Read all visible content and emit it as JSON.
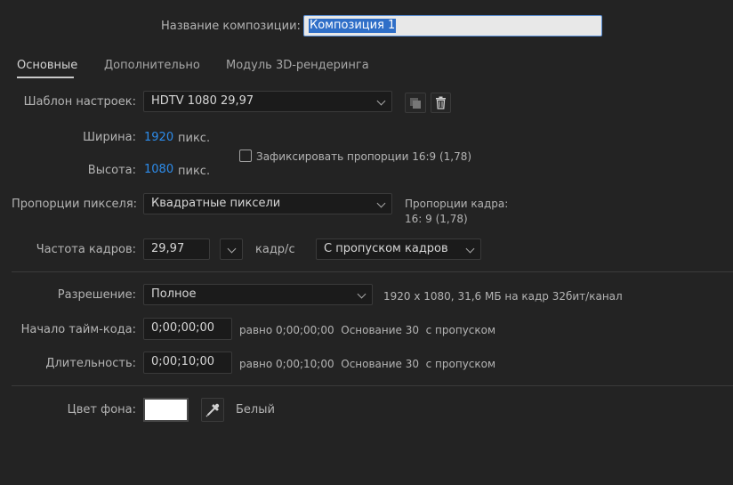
{
  "header": {
    "comp_name_label": "Название композиции:",
    "comp_name_value": "Композиция 1"
  },
  "tabs": [
    {
      "label": "Основные",
      "active": true
    },
    {
      "label": "Дополнительно",
      "active": false
    },
    {
      "label": "Модуль 3D-рендеринга",
      "active": false
    }
  ],
  "preset": {
    "label": "Шаблон настроек:",
    "value": "HDTV 1080 29,97",
    "save_icon": "save-preset-icon",
    "delete_icon": "trash-icon"
  },
  "dimensions": {
    "width_label": "Ширина:",
    "width_value": "1920",
    "height_label": "Высота:",
    "height_value": "1080",
    "unit": "пикс.",
    "lock_label": "Зафиксировать пропорции 16:9 (1,78)",
    "lock_checked": false
  },
  "pixel_aspect": {
    "label": "Пропорции пикселя:",
    "value": "Квадратные пиксели",
    "frame_aspect_label": "Пропорции кадра:",
    "frame_aspect_value": "16: 9 (1,78)"
  },
  "frame_rate": {
    "label": "Частота кадров:",
    "value": "29,97",
    "unit": "кадр/с",
    "mode": "С пропуском кадров"
  },
  "resolution": {
    "label": "Разрешение:",
    "value": "Полное",
    "info": "1920 x 1080, 31,6 МБ на кадр 32бит/канал"
  },
  "start_timecode": {
    "label": "Начало тайм-кода:",
    "value": "0;00;00;00",
    "info": "равно 0;00;00;00  Основание 30  с пропуском"
  },
  "duration": {
    "label": "Длительность:",
    "value": "0;00;10;00",
    "info": "равно 0;00;10;00  Основание 30  с пропуском"
  },
  "background": {
    "label": "Цвет фона:",
    "color": "#ffffff",
    "eyedropper_icon": "eyedropper-icon",
    "color_name": "Белый"
  },
  "colors": {
    "accent": "#2d8ceb",
    "background": "#232323",
    "field": "#1b1b1b"
  }
}
